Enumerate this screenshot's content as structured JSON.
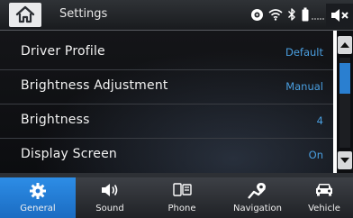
{
  "header": {
    "title": "Settings",
    "home_icon": "home-icon",
    "status_icons": [
      "sirius-icon",
      "wifi-icon",
      "bluetooth-icon",
      "phone-battery-icon",
      "signal-icon"
    ],
    "mute_icon": "mute-icon"
  },
  "list": {
    "rows": [
      {
        "label": "Driver Profile",
        "value": "Default"
      },
      {
        "label": "Brightness Adjustment",
        "value": "Manual"
      },
      {
        "label": "Brightness",
        "value": "4"
      },
      {
        "label": "Display Screen",
        "value": "On"
      }
    ]
  },
  "scrollbar": {
    "up_icon": "scroll-up-arrow-icon",
    "down_icon": "scroll-down-arrow-icon"
  },
  "nav": {
    "tabs": [
      {
        "label": "General",
        "icon": "gear-icon",
        "active": true
      },
      {
        "label": "Sound",
        "icon": "speaker-icon",
        "active": false
      },
      {
        "label": "Phone",
        "icon": "phone-icon",
        "active": false
      },
      {
        "label": "Navigation",
        "icon": "navigation-icon",
        "active": false
      },
      {
        "label": "Vehicle",
        "icon": "car-icon",
        "active": false
      }
    ]
  },
  "colors": {
    "accent": "#2a7fd0",
    "value_text": "#4a9fe0",
    "list_background": "#0f1013",
    "header_background": "#25282c"
  }
}
